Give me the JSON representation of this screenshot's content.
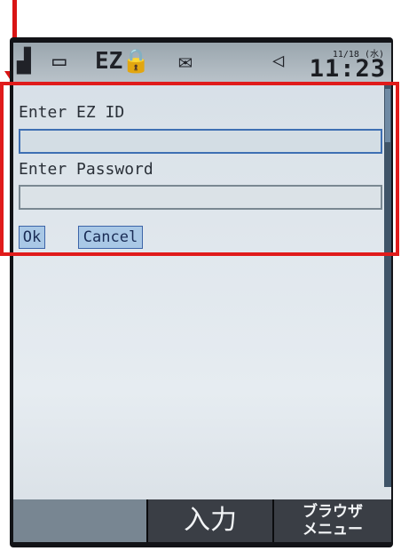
{
  "status": {
    "signal_icon": "signal-icon",
    "battery_icon": "battery-icon",
    "ez_badge": "EZ",
    "lock_icon": "lock-icon",
    "mail_icon": "mail-icon",
    "back_icon": "back-triangle-icon",
    "date": "11/18 (水)",
    "time": "11:23"
  },
  "login": {
    "ez_id_label": "Enter EZ ID",
    "ez_id_value": "",
    "password_label": "Enter Password",
    "password_value": "",
    "ok_label": "Ok",
    "cancel_label": "Cancel"
  },
  "softkeys": {
    "left": "",
    "center": "入力",
    "right_line1": "ブラウザ",
    "right_line2": "メニュー"
  },
  "annotation": {
    "color": "#e01b1b"
  }
}
